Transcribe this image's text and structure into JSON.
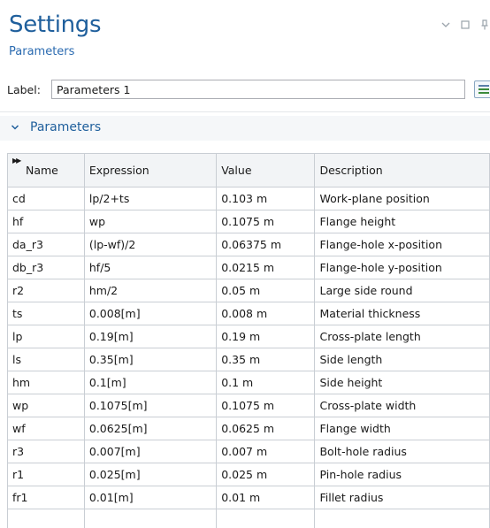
{
  "header": {
    "title": "Settings",
    "subtitle": "Parameters"
  },
  "window_controls": {
    "collapse_icon": "chevron-down-icon",
    "maximize_icon": "square-icon",
    "pin_icon": "pin-icon"
  },
  "label_field": {
    "label": "Label:",
    "value": "Parameters 1"
  },
  "section": {
    "title": "Parameters",
    "expanded": true
  },
  "table": {
    "headers": {
      "name": "Name",
      "expression": "Expression",
      "value": "Value",
      "description": "Description"
    },
    "rows": [
      {
        "name": "cd",
        "expression": "lp/2+ts",
        "value": "0.103 m",
        "description": "Work-plane position"
      },
      {
        "name": "hf",
        "expression": "wp",
        "value": "0.1075 m",
        "description": "Flange height"
      },
      {
        "name": "da_r3",
        "expression": "(lp-wf)/2",
        "value": "0.06375 m",
        "description": "Flange-hole x-position"
      },
      {
        "name": "db_r3",
        "expression": "hf/5",
        "value": "0.0215 m",
        "description": "Flange-hole y-position"
      },
      {
        "name": "r2",
        "expression": "hm/2",
        "value": "0.05 m",
        "description": "Large side round"
      },
      {
        "name": "ts",
        "expression": "0.008[m]",
        "value": "0.008 m",
        "description": "Material thickness"
      },
      {
        "name": "lp",
        "expression": "0.19[m]",
        "value": "0.19 m",
        "description": "Cross-plate length"
      },
      {
        "name": "ls",
        "expression": "0.35[m]",
        "value": "0.35 m",
        "description": "Side length"
      },
      {
        "name": "hm",
        "expression": "0.1[m]",
        "value": "0.1 m",
        "description": "Side height"
      },
      {
        "name": "wp",
        "expression": "0.1075[m]",
        "value": "0.1075 m",
        "description": "Cross-plate width"
      },
      {
        "name": "wf",
        "expression": "0.0625[m]",
        "value": "0.0625 m",
        "description": "Flange width"
      },
      {
        "name": "r3",
        "expression": "0.007[m]",
        "value": "0.007 m",
        "description": "Bolt-hole radius"
      },
      {
        "name": "r1",
        "expression": "0.025[m]",
        "value": "0.025 m",
        "description": "Pin-hole radius"
      },
      {
        "name": "fr1",
        "expression": "0.01[m]",
        "value": "0.01 m",
        "description": "Fillet radius"
      },
      {
        "name": "",
        "expression": "",
        "value": "",
        "description": ""
      }
    ]
  }
}
